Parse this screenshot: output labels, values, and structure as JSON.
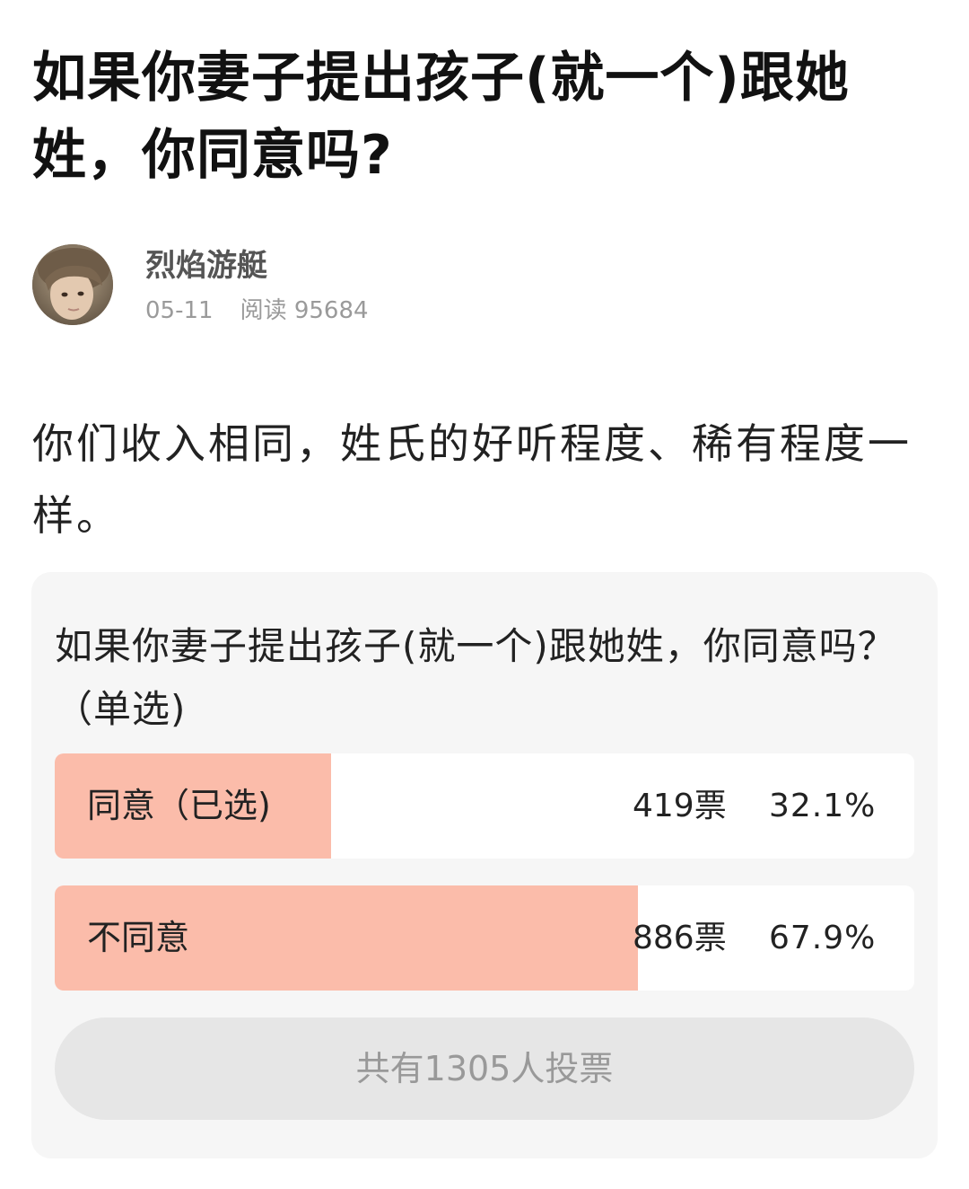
{
  "post": {
    "title": "如果你妻子提出孩子(就一个)跟她姓，你同意吗?",
    "author": {
      "name": "烈焰游艇",
      "date": "05-11",
      "read_label": "阅读",
      "read_count": "95684"
    },
    "body": "你们收入相同，姓氏的好听程度、稀有程度一样。"
  },
  "poll": {
    "question": "如果你妻子提出孩子(就一个)跟她姓，你同意吗？（单选)",
    "options": [
      {
        "label": "同意（已选)",
        "votes": "419票",
        "percent": "32.1%",
        "fraction": 0.321,
        "selected": true
      },
      {
        "label": "不同意",
        "votes": "886票",
        "percent": "67.9%",
        "fraction": 0.679,
        "selected": false
      }
    ],
    "total_label": "共有1305人投票"
  },
  "colors": {
    "bar_fill": "#fbbcaa",
    "poll_bg": "#f6f6f6",
    "button_bg": "#e6e6e6"
  }
}
